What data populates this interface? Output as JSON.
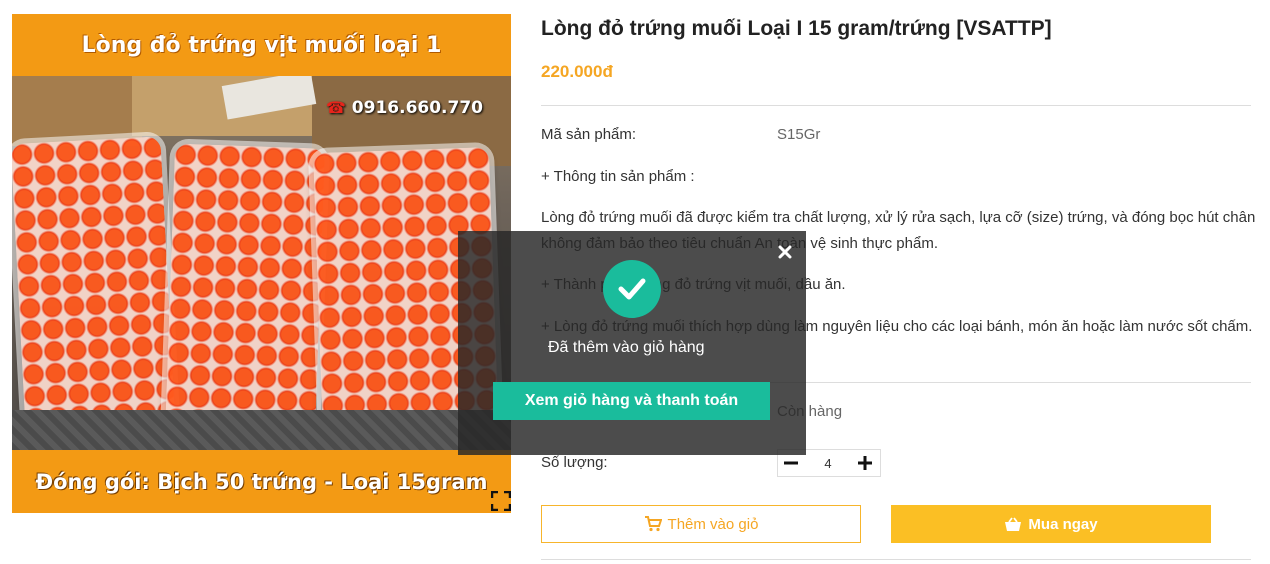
{
  "product": {
    "title": "Lòng đỏ trứng muối Loại I 15 gram/trứng [VSATTP]",
    "price": "220.000đ",
    "image": {
      "banner_top": "Lòng đỏ trứng vịt muối loại 1",
      "hotline": "0916.660.770",
      "banner_bottom": "Đóng gói: Bịch 50 trứng - Loại 15gram"
    },
    "sku_label": "Mã sản phẩm:",
    "sku_value": "S15Gr",
    "info_heading": "+ Thông tin sản phẩm :",
    "desc_1": "Lòng đỏ trứng muối đã được kiểm tra chất lượng, xử lý rửa sạch, lựa cỡ (size) trứng, và đóng bọc hút chân không đảm bảo theo tiêu chuẩn An toàn vệ sinh thực phẩm.",
    "desc_2": "+ Thành phần: lòng đỏ trứng vịt muối, dầu ăn.",
    "desc_3": "+ Lòng đỏ trứng muối thích hợp dùng làm nguyên liệu cho các loại bánh, món ăn hoặc làm nước sốt chấm.",
    "stock_value": "Còn hàng",
    "qty_label": "Số lượng:",
    "qty_value": "4",
    "add_to_cart": "Thêm vào giỏ",
    "buy_now": "Mua ngay"
  },
  "modal": {
    "message": "Đã thêm vào giỏ hàng",
    "checkout_button": "Xem giỏ hàng và thanh toán"
  },
  "colors": {
    "accent": "#f5a623",
    "buy_button": "#fbbf24",
    "modal_accent": "#1abc9c",
    "banner": "#f39a14"
  },
  "icons": [
    "phone-icon",
    "fullscreen-icon",
    "close-icon",
    "checkmark-icon",
    "minus-icon",
    "plus-icon",
    "cart-icon",
    "basket-icon"
  ]
}
